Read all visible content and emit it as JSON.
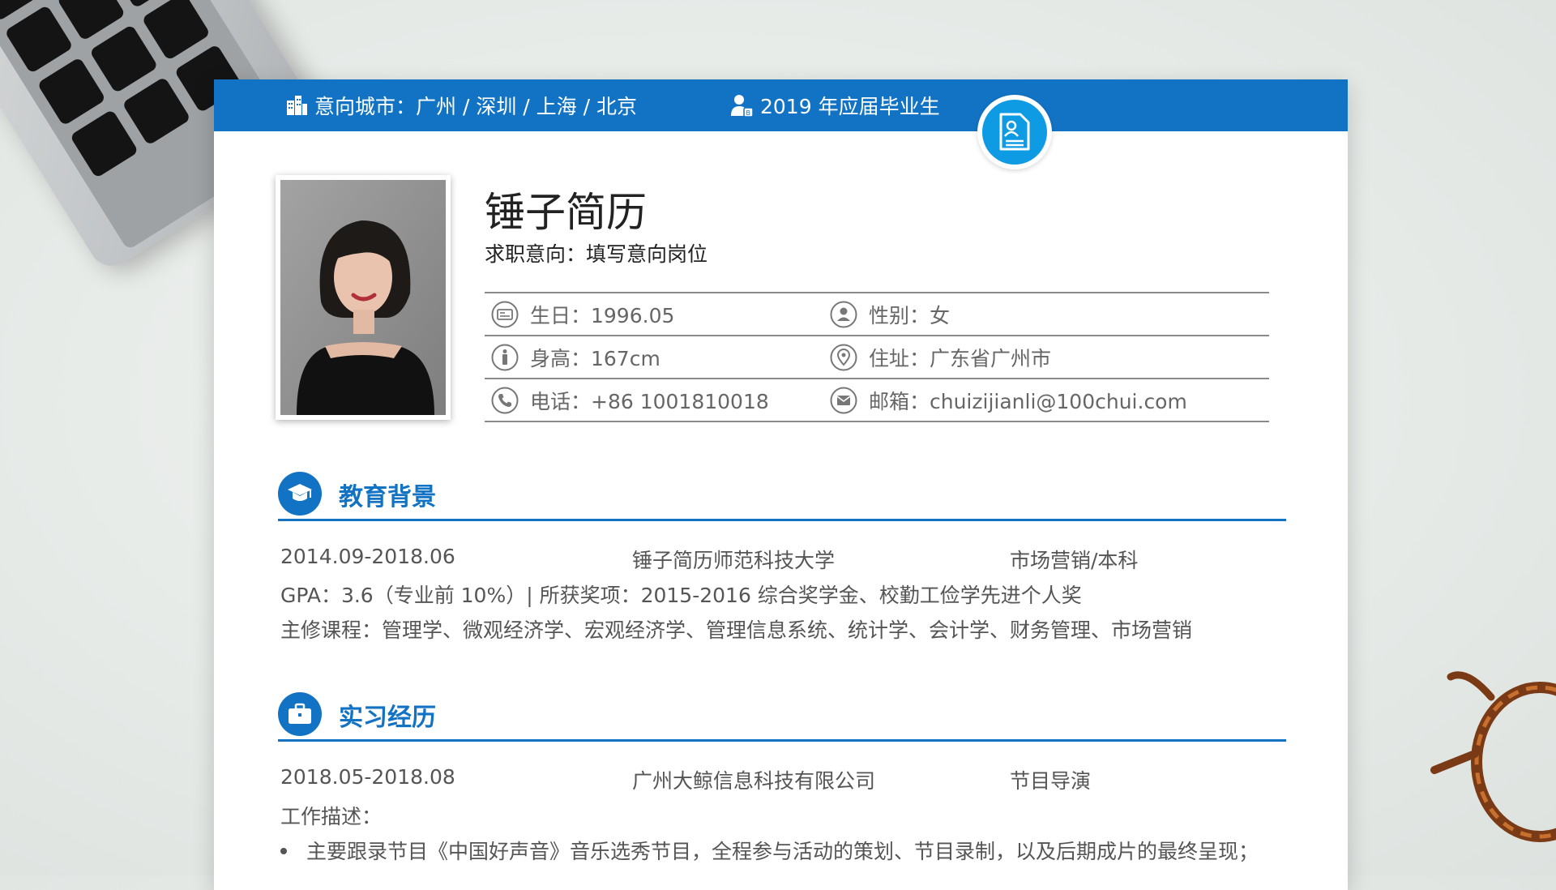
{
  "header": {
    "city_label": "意向城市：广州 / 深圳 / 上海 / 北京",
    "grad_label": "2019 年应届毕业生"
  },
  "profile": {
    "name": "锤子简历",
    "intent": "求职意向：填写意向岗位"
  },
  "info": {
    "birthday": "生日：1996.05",
    "gender": "性别：女",
    "height": "身高：167cm",
    "address": "住址：广东省广州市",
    "phone": "电话：+86 1001810018",
    "email": "邮箱：chuizijianli@100chui.com"
  },
  "education": {
    "title": "教育背景",
    "period": "2014.09-2018.06",
    "school": "锤子简历师范科技大学",
    "major": "市场营销/本科",
    "gpa": "GPA：3.6（专业前 10%）| 所获奖项：2015-2016 综合奖学金、校勤工俭学先进个人奖",
    "courses": "主修课程：管理学、微观经济学、宏观经济学、管理信息系统、统计学、会计学、财务管理、市场营销"
  },
  "internship": {
    "title": "实习经历",
    "period": "2018.05-2018.08",
    "company": "广州大鲸信息科技有限公司",
    "role": "节目导演",
    "desc_label": "工作描述：",
    "bullets": [
      "主要跟录节目《中国好声音》音乐选秀节目，全程参与活动的策划、节目录制，以及后期成片的最终呈现；"
    ]
  },
  "colors": {
    "accent": "#1273c4",
    "badge": "#0f9be3"
  },
  "icons": {
    "city": "buildings-icon",
    "grad": "user-badge-icon",
    "badge": "resume-document-icon",
    "education": "graduation-cap-icon",
    "internship": "briefcase-icon"
  }
}
